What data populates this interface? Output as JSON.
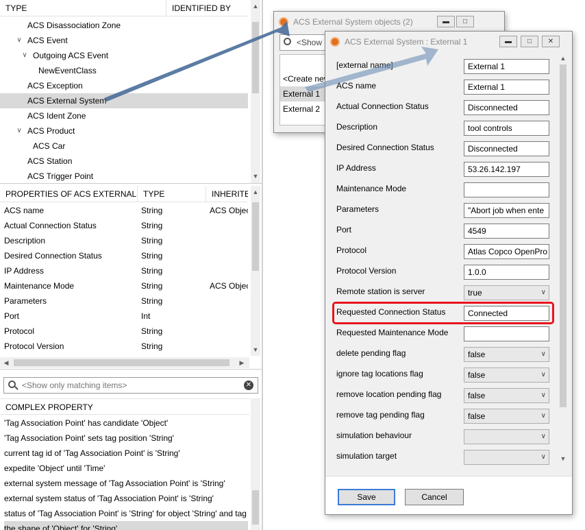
{
  "type_tree": {
    "headers": {
      "type": "TYPE",
      "identified_by": "IDENTIFIED BY"
    },
    "items": [
      {
        "label": "ACS Disassociation Zone",
        "indent": 1,
        "chevron": ""
      },
      {
        "label": "ACS Event",
        "indent": 1,
        "chevron": "expanded"
      },
      {
        "label": "Outgoing ACS Event",
        "indent": 2,
        "chevron": "expanded"
      },
      {
        "label": "NewEventClass",
        "indent": 3,
        "chevron": ""
      },
      {
        "label": "ACS Exception",
        "indent": 1,
        "chevron": ""
      },
      {
        "label": "ACS External System",
        "indent": 1,
        "chevron": "",
        "selected": true
      },
      {
        "label": "ACS Ident Zone",
        "indent": 1,
        "chevron": ""
      },
      {
        "label": "ACS Product",
        "indent": 1,
        "chevron": "expanded"
      },
      {
        "label": "ACS Car",
        "indent": 2,
        "chevron": ""
      },
      {
        "label": "ACS Station",
        "indent": 1,
        "chevron": ""
      },
      {
        "label": "ACS Trigger Point",
        "indent": 1,
        "chevron": ""
      }
    ]
  },
  "properties_table": {
    "headers": {
      "name": "PROPERTIES OF ACS EXTERNAL S...",
      "type": "TYPE",
      "inherited": "INHERITED"
    },
    "rows": [
      {
        "name": "ACS name",
        "type": "String",
        "inherited": "ACS Object"
      },
      {
        "name": "Actual Connection Status",
        "type": "String",
        "inherited": ""
      },
      {
        "name": "Description",
        "type": "String",
        "inherited": ""
      },
      {
        "name": "Desired Connection Status",
        "type": "String",
        "inherited": ""
      },
      {
        "name": "IP Address",
        "type": "String",
        "inherited": ""
      },
      {
        "name": "Maintenance Mode",
        "type": "String",
        "inherited": "ACS Object"
      },
      {
        "name": "Parameters",
        "type": "String",
        "inherited": ""
      },
      {
        "name": "Port",
        "type": "Int",
        "inherited": ""
      },
      {
        "name": "Protocol",
        "type": "String",
        "inherited": ""
      },
      {
        "name": "Protocol Version",
        "type": "String",
        "inherited": ""
      }
    ]
  },
  "complex_panel": {
    "search_placeholder": "<Show only matching items>",
    "header": "COMPLEX PROPERTY",
    "rows": [
      "'Tag Association Point' has candidate 'Object'",
      "'Tag Association Point' sets tag position 'String'",
      "current tag id of 'Tag Association Point' is 'String'",
      "expedite 'Object' until 'Time'",
      "external system message of 'Tag Association Point' is 'String'",
      "external system status of 'Tag Association Point' is 'String'",
      "status of 'Tag Association Point' is 'String' for object 'String' and tag",
      "the shape of 'Object' for 'String'"
    ]
  },
  "objects_window": {
    "title": "ACS External System objects (2)",
    "search_placeholder": "<Show",
    "items": [
      "<Create new",
      "External 1",
      "External 2"
    ]
  },
  "detail_window": {
    "title": "ACS External System : External 1",
    "fields": [
      {
        "label": "[external name]",
        "value": "External 1",
        "kind": "text"
      },
      {
        "label": "ACS name",
        "value": "External 1",
        "kind": "text"
      },
      {
        "label": "Actual Connection Status",
        "value": "Disconnected",
        "kind": "text"
      },
      {
        "label": "Description",
        "value": "tool controls",
        "kind": "text"
      },
      {
        "label": "Desired Connection Status",
        "value": "Disconnected",
        "kind": "text"
      },
      {
        "label": "IP Address",
        "value": "53.26.142.197",
        "kind": "text"
      },
      {
        "label": "Maintenance Mode",
        "value": "",
        "kind": "text"
      },
      {
        "label": "Parameters",
        "value": "\"Abort job when ente",
        "kind": "text"
      },
      {
        "label": "Port",
        "value": "4549",
        "kind": "text"
      },
      {
        "label": "Protocol",
        "value": "Atlas Copco OpenPro",
        "kind": "text"
      },
      {
        "label": "Protocol Version",
        "value": "1.0.0",
        "kind": "text"
      },
      {
        "label": "Remote station is server",
        "value": "true",
        "kind": "dropdown"
      },
      {
        "label": "Requested Connection Status",
        "value": "Connected",
        "kind": "text",
        "highlighted": true
      },
      {
        "label": "Requested Maintenance Mode",
        "value": "",
        "kind": "text"
      },
      {
        "label": "delete pending flag",
        "value": "false",
        "kind": "dropdown"
      },
      {
        "label": "ignore tag locations flag",
        "value": "false",
        "kind": "dropdown"
      },
      {
        "label": "remove location pending flag",
        "value": "false",
        "kind": "dropdown"
      },
      {
        "label": "remove tag pending flag",
        "value": "false",
        "kind": "dropdown"
      },
      {
        "label": "simulation behaviour",
        "value": "",
        "kind": "dropdown"
      },
      {
        "label": "simulation target",
        "value": "",
        "kind": "dropdown"
      }
    ],
    "save_label": "Save",
    "cancel_label": "Cancel"
  },
  "colors": {
    "selection": "#d9d9d9",
    "highlight": "#e8141c",
    "arrow": "#4a6e9a",
    "app_icon": "#e07020"
  }
}
